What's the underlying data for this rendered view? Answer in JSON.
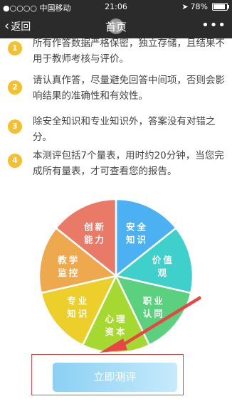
{
  "status_bar": {
    "carrier": "●○○○○ 中国移动",
    "time": "21:06",
    "battery": "78%",
    "battery_level": 0.78,
    "wifi_icon": "wifi-icon",
    "location_icon": "location-arrow-icon"
  },
  "nav": {
    "back_label": "返回",
    "title": "首页",
    "more_icon": "more-dots-icon"
  },
  "notes": [
    {
      "number": "1",
      "text": "所有作答数据严格保密，独立存储，且结果不用于教师考核与评价。"
    },
    {
      "number": "2",
      "text": "请认真作答，尽量避免回答中间项，否则会影响结果的准确性和有效性。"
    },
    {
      "number": "3",
      "text": "除安全知识和专业知识外，答案没有对错之分。"
    },
    {
      "number": "4",
      "text": "本测评包括7个量表，用时约20分钟，当您完成所有量表，才可查看您的报告。"
    }
  ],
  "chart_data": {
    "type": "pie",
    "categories": [
      "安全知识",
      "价值观",
      "职业认同",
      "心理资本",
      "专业知识",
      "教学监控",
      "创新能力"
    ],
    "line1": [
      "安全",
      "价值",
      "职业",
      "心理",
      "专业",
      "教学",
      "创新"
    ],
    "line2": [
      "知识",
      "观",
      "认同",
      "资本",
      "知识",
      "监控",
      "能力"
    ],
    "values": [
      1,
      1,
      1,
      1,
      1,
      1,
      1
    ],
    "colors": [
      "#4cb1f2",
      "#3fd0cb",
      "#5bd07e",
      "#a6d832",
      "#edcf2c",
      "#eea84e",
      "#e97a68"
    ]
  },
  "start_button": {
    "label": "立即测评"
  }
}
